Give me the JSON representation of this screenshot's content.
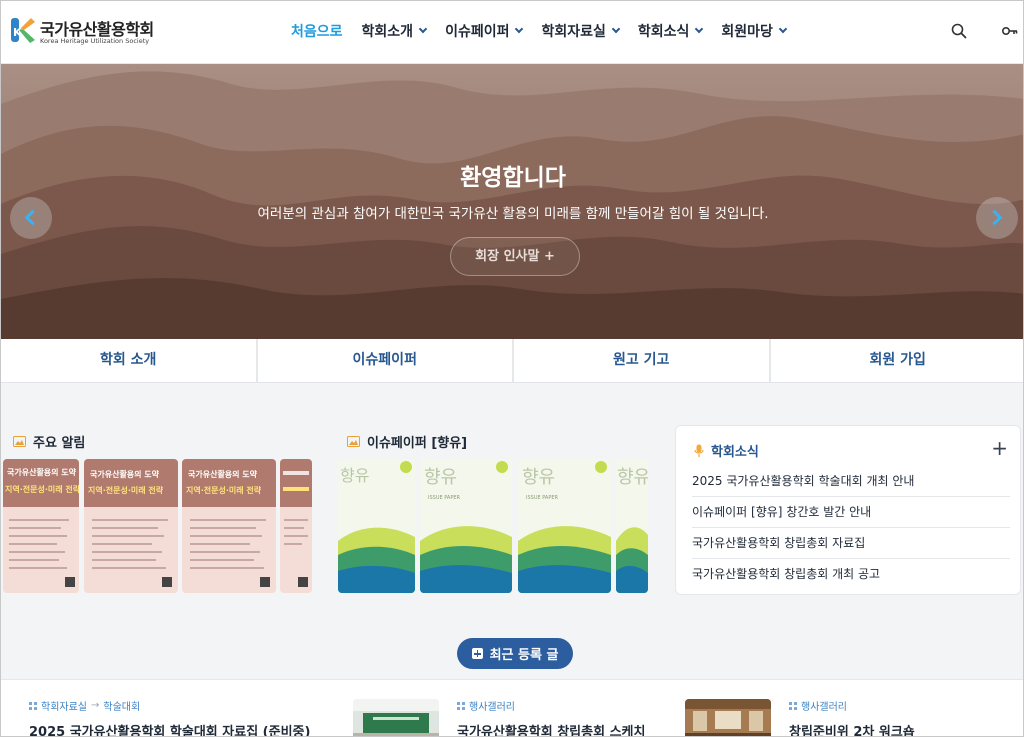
{
  "brand": {
    "title": "국가유산활용학회",
    "subtitle": "Korea Heritage Utilization Society",
    "mark_letter": "K",
    "colors": {
      "orange": "#f4a13a",
      "blue": "#2f83c8",
      "green": "#55b66a"
    }
  },
  "nav": {
    "items": [
      {
        "label": "처음으로",
        "active": true,
        "dropdown": false
      },
      {
        "label": "학회소개",
        "active": false,
        "dropdown": true
      },
      {
        "label": "이슈페이퍼",
        "active": false,
        "dropdown": true
      },
      {
        "label": "학회자료실",
        "active": false,
        "dropdown": true
      },
      {
        "label": "학회소식",
        "active": false,
        "dropdown": true
      },
      {
        "label": "회원마당",
        "active": false,
        "dropdown": true
      }
    ],
    "icons": [
      "search-icon",
      "key-icon"
    ]
  },
  "hero": {
    "title": "환영합니다",
    "text": "여러분의 관심과 참여가 대한민국 국가유산 활용의 미래를 함께 만들어갈 힘이 될 것입니다.",
    "button": "회장 인사말 +"
  },
  "quick_links": [
    "학회 소개",
    "이슈페이퍼",
    "원고 기고",
    "회원 가입"
  ],
  "notices": {
    "title": "주요 알림",
    "poster_headline_1": "국가유산활용의 도약",
    "poster_headline_2": "지역·전문성·미래 전략"
  },
  "issue_papers": {
    "title": "이슈페이퍼 [향유]",
    "cover_title": "향유",
    "cover_label": "ISSUE PAPER"
  },
  "news": {
    "title": "학회소식",
    "more": "+",
    "items": [
      "2025 국가유산활용학회 학술대회 개최 안내",
      "이슈페이퍼 [향유] 창간호 발간 안내",
      "국가유산활용학회 창립총회 자료집",
      "국가유산활용학회 창립총회 개최 공고"
    ]
  },
  "recent_button": "최근 등록 글",
  "recent": [
    {
      "category": "학회자료실",
      "subcategory": "학술대회",
      "title": "2025 국가유산활용학회 학술대회 자료집 (준비중)"
    },
    {
      "category": "행사갤러리",
      "subcategory": "",
      "title": "국가유산활용학회 창립총회 스케치"
    },
    {
      "category": "행사갤러리",
      "subcategory": "",
      "title": "창립준비위 2차 워크숍"
    }
  ],
  "colors": {
    "accent": "#1e9bdc",
    "navy": "#27578f",
    "button": "#2c5d9e",
    "hero_base": "#8c6b5f"
  }
}
